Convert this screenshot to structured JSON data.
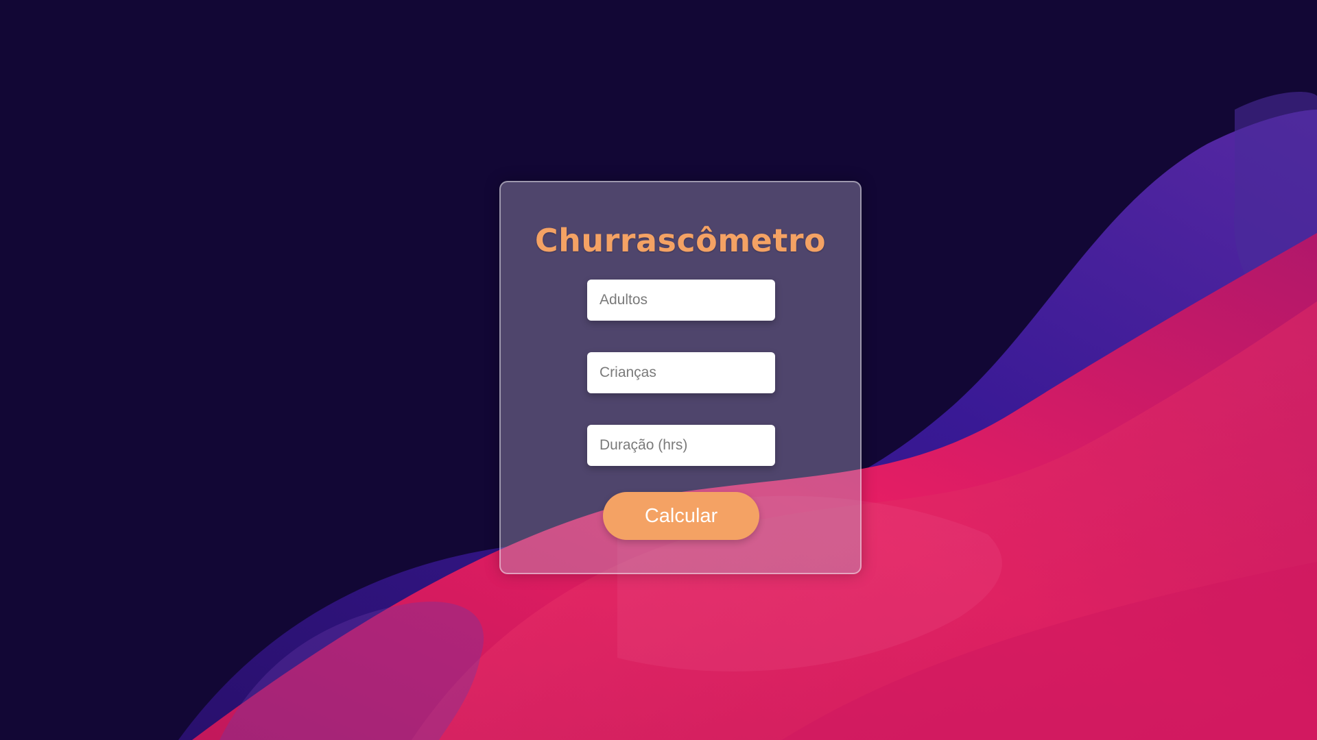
{
  "app": {
    "title": "Churrascômetro"
  },
  "form": {
    "adultos_placeholder": "Adultos",
    "criancas_placeholder": "Crianças",
    "duracao_placeholder": "Duração (hrs)",
    "adultos_value": "",
    "criancas_value": "",
    "duracao_value": ""
  },
  "actions": {
    "calcular_label": "Calcular"
  },
  "colors": {
    "background": "#120735",
    "accent": "#f4a264",
    "wave_purple": "#3a1a8a",
    "wave_pink": "#e8186e"
  }
}
